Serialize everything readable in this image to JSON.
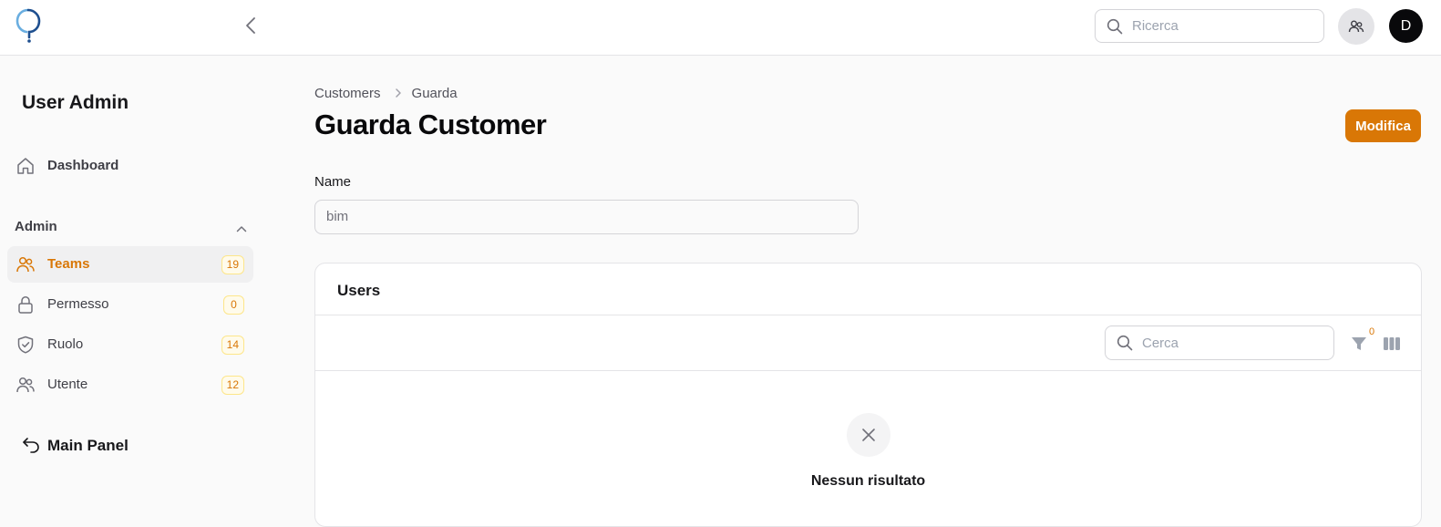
{
  "topbar": {
    "search_placeholder": "Ricerca",
    "avatar_initial": "D"
  },
  "sidebar": {
    "title": "User Admin",
    "dashboard_label": "Dashboard",
    "group": {
      "label": "Admin"
    },
    "items": [
      {
        "label": "Teams",
        "count": "19",
        "active": true,
        "icon": "users-icon"
      },
      {
        "label": "Permesso",
        "count": "0",
        "active": false,
        "icon": "lock-icon"
      },
      {
        "label": "Ruolo",
        "count": "14",
        "active": false,
        "icon": "shield-check-icon"
      },
      {
        "label": "Utente",
        "count": "12",
        "active": false,
        "icon": "users-icon"
      }
    ],
    "main_panel_label": "Main Panel"
  },
  "breadcrumb": {
    "parent": "Customers",
    "current": "Guarda"
  },
  "page": {
    "title": "Guarda Customer",
    "edit_button": "Modifica"
  },
  "form": {
    "name_label": "Name",
    "name_value": "bim"
  },
  "users_panel": {
    "title": "Users",
    "search_placeholder": "Cerca",
    "filter_count": "0",
    "empty_text": "Nessun risultato"
  },
  "colors": {
    "accent": "#d97706",
    "badge_bg": "#fffbeb",
    "badge_border": "#fde68a",
    "active_item_bg": "#f0f0f1",
    "logo_blue": "#1e73be"
  }
}
